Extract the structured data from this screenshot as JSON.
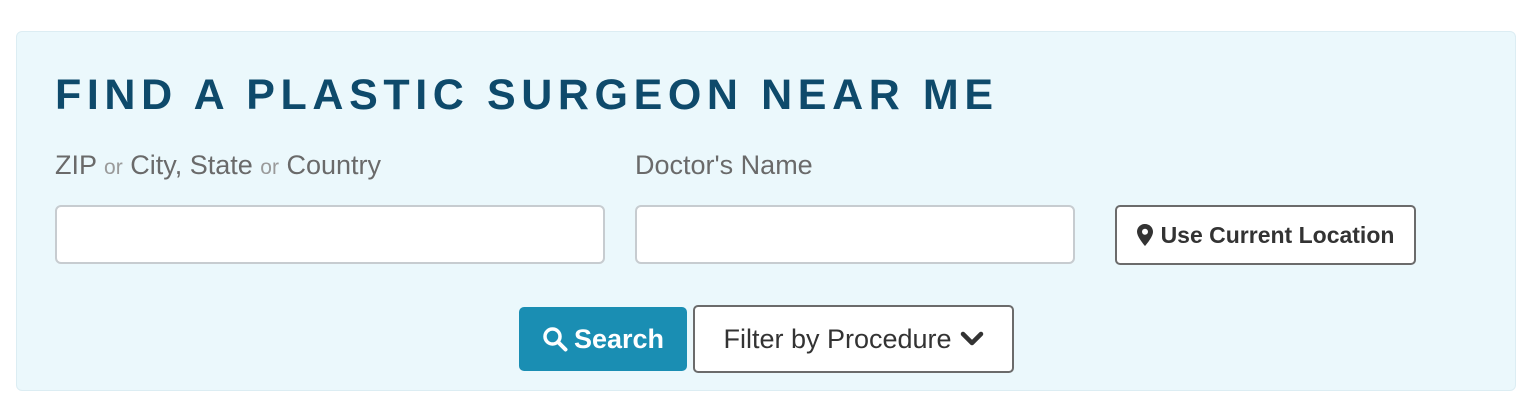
{
  "finder": {
    "title": "FIND A PLASTIC SURGEON NEAR ME",
    "location_label": {
      "zip": "ZIP",
      "or_1": "or",
      "city_state": "City, State",
      "or_2": "or",
      "country": "Country"
    },
    "location_input": {
      "value": "",
      "placeholder": ""
    },
    "doctor_label": "Doctor's Name",
    "doctor_input": {
      "value": "",
      "placeholder": ""
    },
    "use_location_button": {
      "label": "Use Current Location",
      "icon": "map-marker-icon"
    },
    "search_button": {
      "label": "Search",
      "icon": "search-icon"
    },
    "filter_button": {
      "label": "Filter by Procedure",
      "icon": "chevron-down-icon"
    }
  },
  "colors": {
    "panel_background": "#ebf8fc",
    "title": "#0e4a6b",
    "search_button": "#1a8eb3",
    "label_text": "#6a6a6a"
  }
}
